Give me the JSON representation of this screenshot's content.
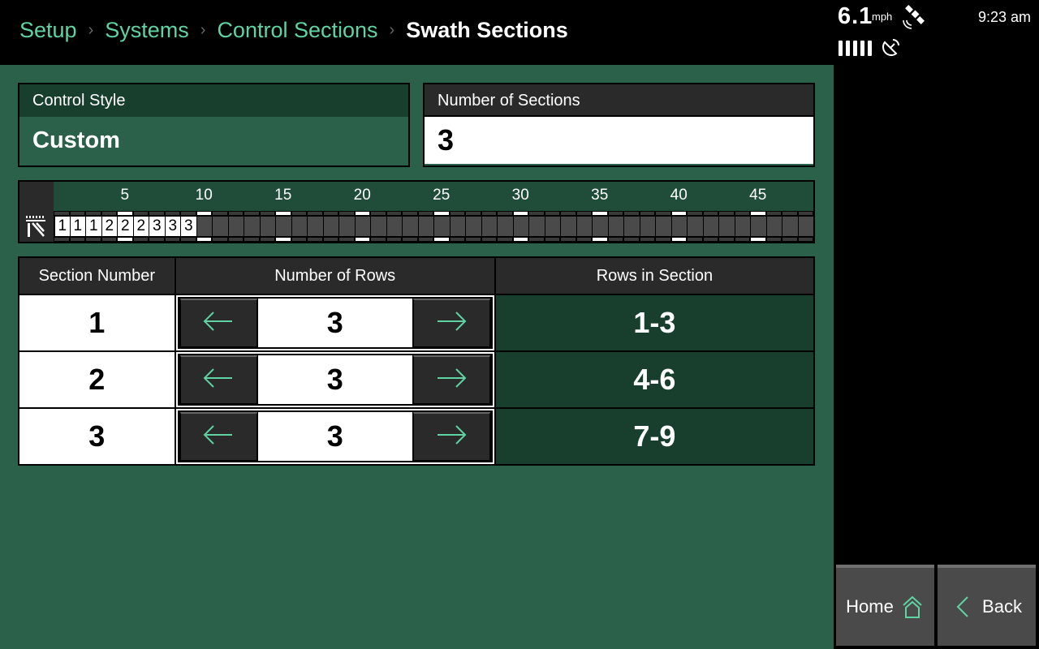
{
  "breadcrumb": {
    "items": [
      "Setup",
      "Systems",
      "Control Sections"
    ],
    "current": "Swath Sections",
    "separator": "›"
  },
  "status": {
    "speed": "6.1",
    "speed_unit": "mph",
    "time": "9:23 am",
    "signal_bars": 5,
    "icons": [
      "satellite-icon",
      "satellite-dish-icon"
    ]
  },
  "control_style": {
    "label": "Control Style",
    "value": "Custom"
  },
  "number_of_sections": {
    "label": "Number of Sections",
    "value": "3"
  },
  "row_strip": {
    "total_rows": 48,
    "tick_labels": [
      "5",
      "10",
      "15",
      "20",
      "25",
      "30",
      "35",
      "40",
      "45"
    ],
    "assigned_rows": [
      "1",
      "1",
      "1",
      "2",
      "2",
      "2",
      "3",
      "3",
      "3"
    ],
    "icon": "planter-icon"
  },
  "table": {
    "headers": [
      "Section Number",
      "Number of Rows",
      "Rows in Section"
    ],
    "rows": [
      {
        "section": "1",
        "rows": "3",
        "range": "1-3"
      },
      {
        "section": "2",
        "rows": "3",
        "range": "4-6"
      },
      {
        "section": "3",
        "rows": "3",
        "range": "7-9"
      }
    ]
  },
  "nav": {
    "home_label": "Home",
    "back_label": "Back"
  },
  "colors": {
    "accent": "#5fd3a3",
    "background": "#2b614b",
    "dark_green": "#183e2e",
    "panel": "#2a2a2a"
  }
}
